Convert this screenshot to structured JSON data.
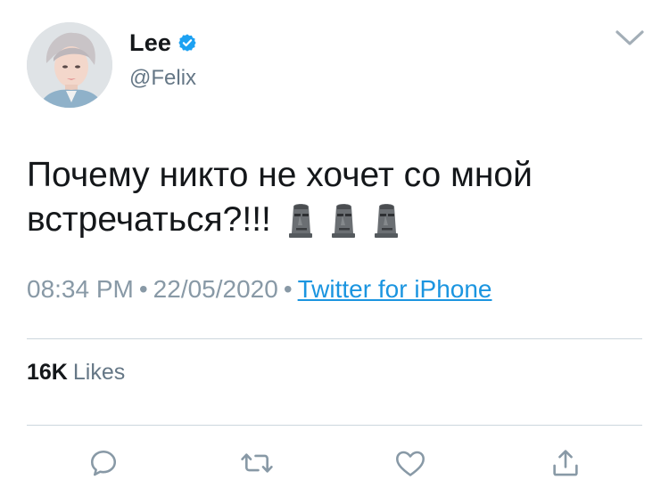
{
  "user": {
    "display_name": "Lee",
    "handle": "@Felix",
    "verified": true,
    "avatar_icon": "profile-photo"
  },
  "tweet": {
    "text": "Почему никто не хочет со мной встречаться?!!!",
    "emoji": [
      "moai",
      "moai",
      "moai"
    ],
    "time": "08:34 PM",
    "date": "22/05/2020",
    "separator": "•",
    "source": "Twitter for iPhone"
  },
  "stats": {
    "likes_count": "16K",
    "likes_label": "Likes"
  },
  "actions": [
    {
      "icon": "reply-icon"
    },
    {
      "icon": "retweet-icon"
    },
    {
      "icon": "like-icon"
    },
    {
      "icon": "share-icon"
    }
  ],
  "colors": {
    "text_primary": "#14171a",
    "text_secondary": "#657786",
    "meta_gray": "#8899a6",
    "link_blue": "#1b95e0",
    "verified_blue": "#1da1f2",
    "divider": "#ccd6dd"
  }
}
